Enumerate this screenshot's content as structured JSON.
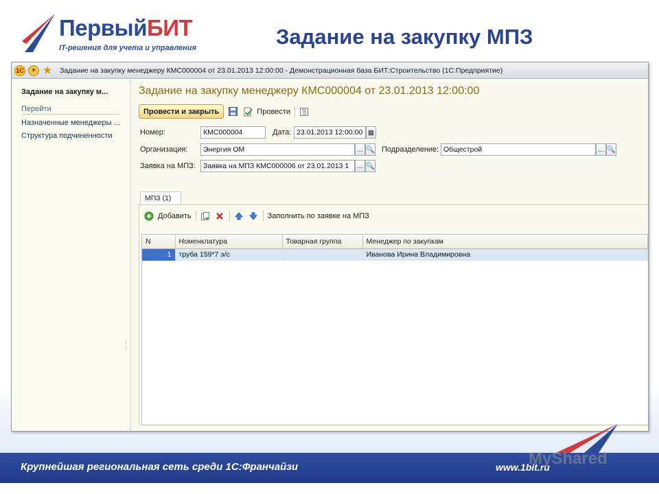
{
  "slide": {
    "logo_main_a": "Первый",
    "logo_main_b": "БИТ",
    "logo_sub": "IT-решения для учета и управления",
    "title": "Задание на закупку МПЗ",
    "footer_left": "Крупнейшая региональная сеть среди 1С:Франчайзи",
    "footer_right": "www.1bit.ru",
    "watermark": "MyShared"
  },
  "window": {
    "title": "Задание на закупку менеджеру КМС000004 от 23.01.2013 12:00:00 - Демонстрационная база БИТ:Строительство  (1С:Предприятие)",
    "icons": [
      "1c-logo-icon",
      "dropdown-menu-icon",
      "favorite-star-icon"
    ]
  },
  "sidebar": {
    "title": "Задание на закупку м...",
    "section": "Перейти",
    "links": [
      "Назначенные менеджеры ...",
      "Структура подчиненности"
    ]
  },
  "form": {
    "title": "Задание на закупку менеджеру КМС000004 от 23.01.2013 12:00:00",
    "toolbar": {
      "post_close": "Провести и закрыть",
      "post": "Провести"
    },
    "fields": {
      "number_label": "Номер:",
      "number_value": "КМС000004",
      "date_label": "Дата:",
      "date_value": "23.01.2013 12:00:00",
      "org_label": "Организация:",
      "org_value": "Энергия ОМ",
      "dept_label": "Подразделение:",
      "dept_value": "Общестрой",
      "request_label": "Заявка на МПЗ:",
      "request_value": "Заявка на МПЗ КМС000006 от 23.01.2013 1"
    },
    "tab": "МПЗ (1)",
    "table_toolbar": {
      "add": "Добавить",
      "fill": "Заполнить по заявке на МПЗ"
    },
    "table": {
      "columns": [
        "N",
        "Номенклатура",
        "Товарная группа",
        "Менеджер по закупкам"
      ],
      "rows": [
        [
          "1",
          "труба 159*7  э/с",
          "",
          "Иванова Ирина Владимировна"
        ]
      ]
    }
  },
  "colors": {
    "brand_blue": "#2b4a9a",
    "form_title": "#8a6a10",
    "footer": "#1f3a86"
  }
}
